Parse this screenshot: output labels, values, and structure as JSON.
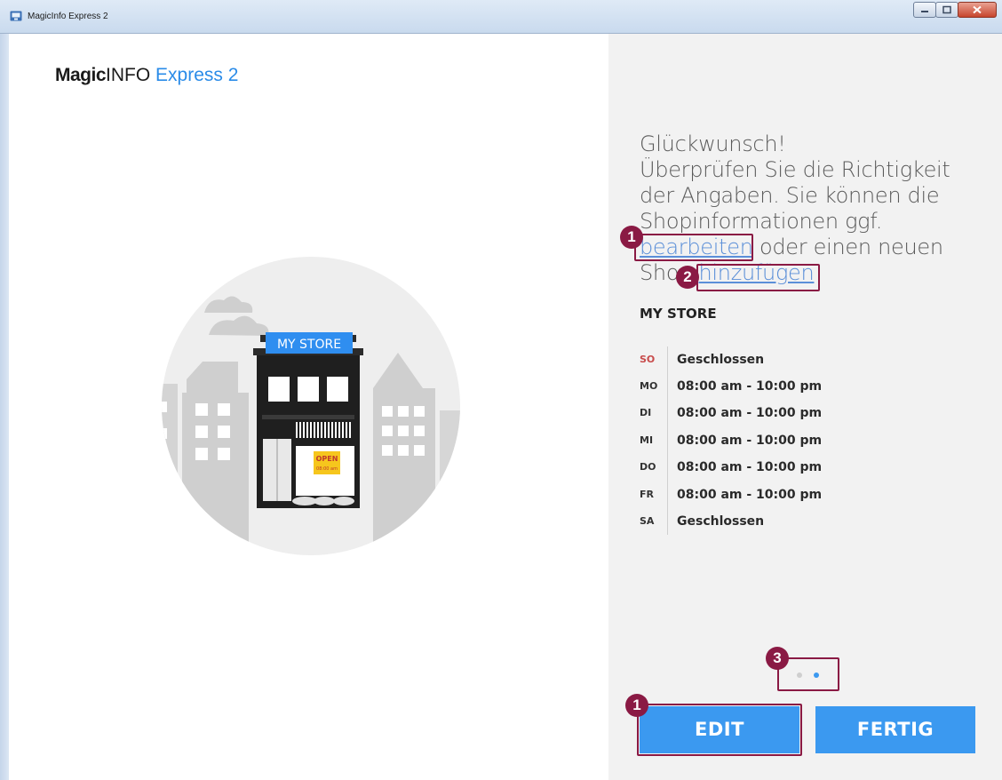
{
  "window": {
    "title": "MagicInfo Express 2"
  },
  "logo": {
    "part1": "Magic",
    "part2": "INFO",
    "part3": "Express 2"
  },
  "illustration": {
    "sign": "MY STORE",
    "open_label": "OPEN",
    "open_time": "08:00 am"
  },
  "message": {
    "line1": "Glückwunsch!",
    "line2a": "Überprüfen Sie die Richtigkeit",
    "line2b": "der Angaben. Sie können die",
    "line2c": "Shopinformationen ggf.",
    "edit_link": "bearbeiten",
    "line3a": " oder einen neuen",
    "line3b": "Shop ",
    "add_link": "hinzufügen"
  },
  "store": {
    "name": "MY STORE",
    "hours": [
      {
        "day": "SO",
        "time": "Geschlossen"
      },
      {
        "day": "MO",
        "time": "08:00 am - 10:00 pm"
      },
      {
        "day": "DI",
        "time": "08:00 am - 10:00 pm"
      },
      {
        "day": "MI",
        "time": "08:00 am - 10:00 pm"
      },
      {
        "day": "DO",
        "time": "08:00 am - 10:00 pm"
      },
      {
        "day": "FR",
        "time": "08:00 am - 10:00 pm"
      },
      {
        "day": "SA",
        "time": "Geschlossen"
      }
    ]
  },
  "pagination": {
    "current": 2,
    "total": 2
  },
  "buttons": {
    "edit": "EDIT",
    "done": "FERTIG"
  },
  "annotations": [
    "1",
    "2",
    "3",
    "1"
  ],
  "colors": {
    "accent": "#3b99f0",
    "annotation": "#8a1a44",
    "sunday": "#c84b4b",
    "link": "#5b8fd8"
  }
}
